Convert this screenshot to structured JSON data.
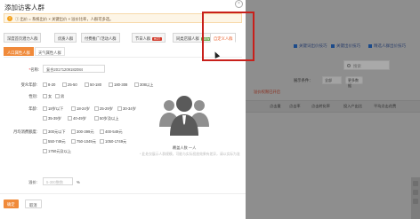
{
  "modal": {
    "title": "添加访客人群",
    "close_glyph": "×",
    "notice": "ⓘ 出价 = 系统出价 × 关键出价 × 溢价比率，人群可多选。"
  },
  "tabs": [
    {
      "label": "深度首页潜力人群",
      "badge": ""
    },
    {
      "label": "优质人群",
      "badge": ""
    },
    {
      "label": "付费推广/活动人群",
      "badge": ""
    },
    {
      "label": "节日人群",
      "badge": "HOT"
    },
    {
      "label": "同类店铺人群",
      "badge": "NEW"
    },
    {
      "label": "自定义人群",
      "badge": ""
    }
  ],
  "subtabs": [
    {
      "label": "人口属性人群"
    },
    {
      "label": "天气属性人群"
    }
  ],
  "form": {
    "name_label": "名称:",
    "name_value": "复合20171209182084",
    "age_label": "受众年龄:",
    "age_options": [
      "8-20",
      "25-50",
      "50-180",
      "180-308",
      "308以上"
    ],
    "gender_label": "性别:",
    "gender_options": [
      "女",
      "男"
    ],
    "age2_label": "年龄:",
    "age2_options": [
      "18岁以下",
      "18-24岁",
      "25-29岁",
      "30-34岁",
      "35-39岁",
      "40-49岁",
      "50岁及以上"
    ],
    "spend_label": "月均消费额度:",
    "spend_options": [
      "300元以下",
      "300-399元",
      "400-549元",
      "550-749元",
      "750-1049元",
      "1050-1749元",
      "1750元及以上"
    ],
    "premium_label": "溢价:",
    "premium_placeholder": "5-300整数",
    "premium_unit": "%"
  },
  "preview": {
    "count_caption": "覆盖人数 一人",
    "hint": "* 此处仅展示人群规模，可能与实际投放效果有差异，请以实际为准"
  },
  "footer": {
    "confirm_label": "确定",
    "cancel_label": "取消"
  },
  "background": {
    "links": [
      "关键词出价技巧",
      "关键出价技巧",
      "精选人群出价技巧"
    ],
    "search_placeholder": "搜索",
    "filter_label": "展示条件：",
    "filter_value": "全部",
    "btn_label": "更多数据",
    "warning": "溢价权限已开启",
    "columns": [
      "点击量",
      "点击率",
      "点击转化率",
      "投入产出比",
      "平均点击花费"
    ]
  },
  "colors": {
    "accent": "#f08a3a",
    "active_tab_text": "#e95f2b",
    "highlight": "#c8201b",
    "hot_badge": "#d23b2b"
  }
}
